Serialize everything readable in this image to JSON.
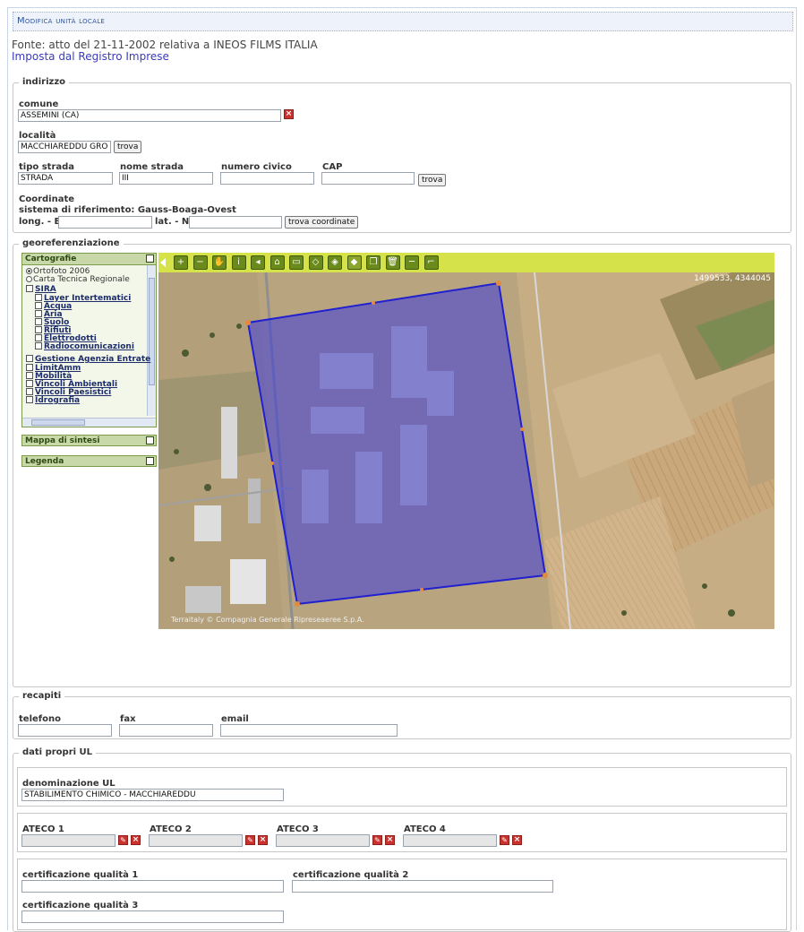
{
  "page": {
    "title": "Modifica unità locale",
    "source_text": "Fonte: atto del 21-11-2002 relativa a INEOS FILMS ITALIA",
    "source_link": "Imposta dal Registro Imprese"
  },
  "indirizzo": {
    "legend": "indirizzo",
    "comune_label": "comune",
    "comune_value": "ASSEMINI (CA)",
    "localita_label": "località",
    "localita_value": "MACCHIAREDDU GRO",
    "trova_label": "trova",
    "tipo_strada_label": "tipo strada",
    "tipo_strada_value": "STRADA",
    "nome_strada_label": "nome strada",
    "nome_strada_value": "III",
    "numero_civico_label": "numero civico",
    "numero_civico_value": "",
    "cap_label": "CAP",
    "cap_value": "",
    "coordinate_label": "Coordinate",
    "sistema_label": "sistema di riferimento: Gauss-Boaga-Ovest",
    "long_label": "long. - E",
    "long_value": "",
    "lat_label": "lat. - N",
    "lat_value": "",
    "trova_coordinate_label": "trova coordinate"
  },
  "georef": {
    "legend": "georeferenziazione",
    "cartografie_title": "Cartografie",
    "layers": [
      {
        "label": "Ortofoto 2006",
        "kind": "radio-on"
      },
      {
        "label": "Carta Tecnica Regionale",
        "kind": "radio"
      },
      {
        "label": "SIRA",
        "kind": "check"
      },
      {
        "label": "Layer Intertematici",
        "kind": "check"
      },
      {
        "label": "Acqua",
        "kind": "check"
      },
      {
        "label": "Aria",
        "kind": "check"
      },
      {
        "label": "Suolo",
        "kind": "check"
      },
      {
        "label": "Rifiuti",
        "kind": "check"
      },
      {
        "label": "Elettrodotti",
        "kind": "check"
      },
      {
        "label": "Radiocomunicazioni",
        "kind": "check"
      },
      {
        "label": "Gestione Agenzia Entrate",
        "kind": "check"
      },
      {
        "label": "LimitAmm",
        "kind": "check"
      },
      {
        "label": "Mobilità",
        "kind": "check"
      },
      {
        "label": "Vincoli Ambientali",
        "kind": "check"
      },
      {
        "label": "Vincoli Paesistici",
        "kind": "check"
      },
      {
        "label": "Idrografia",
        "kind": "check"
      }
    ],
    "mappa_sintesi_title": "Mappa di sintesi",
    "legenda_title": "Legenda",
    "coords_readout": "1499533, 4344045",
    "copyright": "Terraitaly © Compagnia Generale Ripreseaeree S.p.A.",
    "tools": [
      "zoom-in-icon",
      "zoom-out-icon",
      "pan-hand-icon",
      "info-icon",
      "back-icon",
      "home-icon",
      "select-icon",
      "polygon-icon",
      "polygon-edit-icon",
      "polygon-active-icon",
      "copy-icon",
      "trash-icon",
      "measure-line-icon",
      "measure-area-icon"
    ],
    "polygon_color": "#2f2fd8"
  },
  "recapiti": {
    "legend": "recapiti",
    "telefono_label": "telefono",
    "telefono_value": "",
    "fax_label": "fax",
    "fax_value": "",
    "email_label": "email",
    "email_value": ""
  },
  "dati_ul": {
    "legend": "dati propri UL",
    "denominazione_label": "denominazione UL",
    "denominazione_value": "STABILIMENTO CHIMICO - MACCHIAREDDU",
    "ateco1_label": "ATECO 1",
    "ateco2_label": "ATECO 2",
    "ateco3_label": "ATECO 3",
    "ateco4_label": "ATECO 4",
    "cert1_label": "certificazione qualità 1",
    "cert2_label": "certificazione qualità 2",
    "cert3_label": "certificazione qualità 3"
  }
}
